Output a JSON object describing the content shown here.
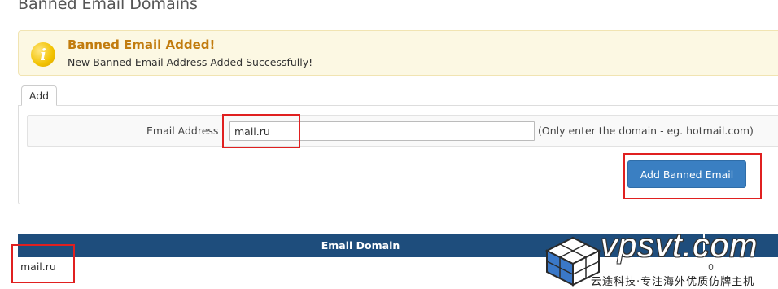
{
  "page": {
    "title": "Banned Email Domains"
  },
  "alert": {
    "title": "Banned Email Added!",
    "message": "New Banned Email Address Added Successfully!",
    "icon": "info-icon"
  },
  "tabs": [
    {
      "label": "Add",
      "active": true
    }
  ],
  "form": {
    "email_label": "Email Address",
    "email_value": "mail.ru",
    "hint": "(Only enter the domain - eg. hotmail.com)",
    "submit_label": "Add Banned Email"
  },
  "table": {
    "headers": [
      "Email Domain"
    ],
    "rows": [
      {
        "domain": "mail.ru",
        "count": "0"
      }
    ]
  },
  "watermark": {
    "text": "vpsvt.com",
    "subtitle": "云途科技·专注海外优质仿牌主机"
  },
  "colors": {
    "header_bg": "#1e4d7c",
    "button_bg": "#3a7fc2",
    "alert_bg": "#fcf8e3",
    "alert_title": "#c27c0e",
    "highlight": "#e02020"
  }
}
